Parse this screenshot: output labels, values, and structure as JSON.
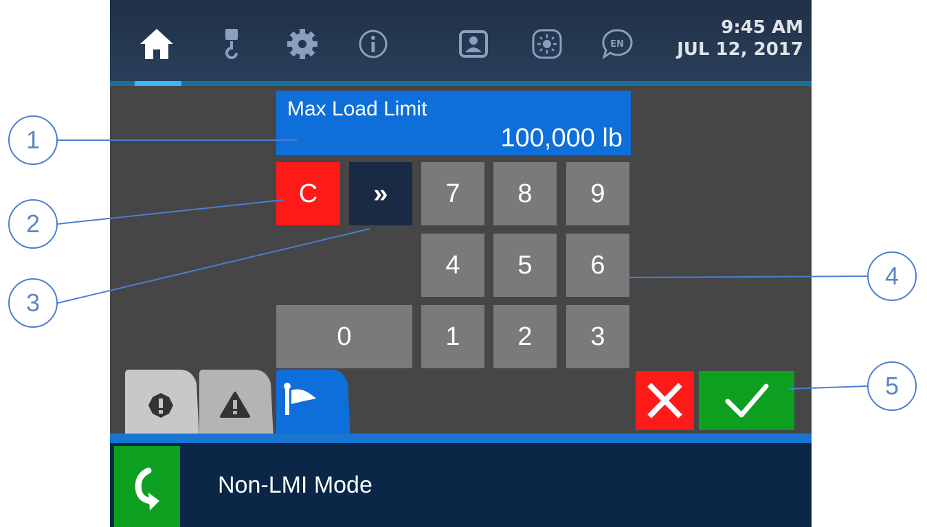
{
  "topbar": {
    "icons": [
      "home-icon",
      "crane-hook-icon",
      "gear-icon",
      "info-icon",
      "operator-icon",
      "brightness-icon",
      "language-icon"
    ],
    "language_badge": "EN",
    "time": "9:45 AM",
    "date": "JUL 12, 2017"
  },
  "entry": {
    "label": "Max Load Limit",
    "value": "100,000 lb"
  },
  "keypad": {
    "clear": "C",
    "next": "»",
    "row1": [
      "7",
      "8",
      "9"
    ],
    "row2": [
      "4",
      "5",
      "6"
    ],
    "row3": [
      "0",
      "1",
      "2",
      "3"
    ]
  },
  "tabs": [
    "stop-alarm-icon",
    "warning-icon",
    "flag-icon"
  ],
  "actions": {
    "cancel_icon": "close-icon",
    "confirm_icon": "checkmark-icon"
  },
  "status": {
    "mode": "Non-LMI Mode",
    "mode_icon": "curved-arrow-icon"
  },
  "callouts": [
    "1",
    "2",
    "3",
    "4",
    "5"
  ],
  "colors": {
    "field_blue": "#0e6fda",
    "clear_red": "#ff1a1a",
    "confirm_green": "#0da020",
    "navy": "#0b2747",
    "key_gray": "#7a7a7a"
  }
}
